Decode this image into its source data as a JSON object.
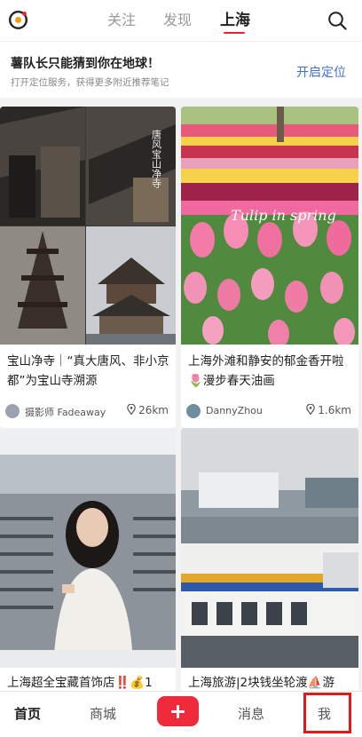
{
  "topnav": {
    "tabs": [
      "关注",
      "发现",
      "上海"
    ],
    "active_tab": "上海",
    "accent": "#e8242c"
  },
  "banner": {
    "title": "薯队长只能猜到你在地球！",
    "subtitle": "打开定位服务，获得更多附近推荐笔记",
    "button": "开启定位",
    "button_color": "#3e70d6"
  },
  "feed": {
    "cards": [
      {
        "title": "宝山净寺｜“真大唐风、非小京都”为宝山寺溯源",
        "author": "摄影师 Fadeaway",
        "distance": "26km",
        "image_text": "唐风宝山净寺"
      },
      {
        "title": "上海外滩和静安的郁金香开啦🌷漫步春天油画",
        "author": "DannyZhou",
        "distance": "1.6km",
        "image_text": "Tulip in spring"
      },
      {
        "title": "上海超全宝藏首饰店‼️💰1"
      },
      {
        "title": "上海旅游|2块钱坐轮渡⛵游"
      }
    ]
  },
  "bottomnav": {
    "home": "首页",
    "mall": "商城",
    "messages": "消息",
    "me": "我",
    "plus_color": "#ee2a3b"
  }
}
